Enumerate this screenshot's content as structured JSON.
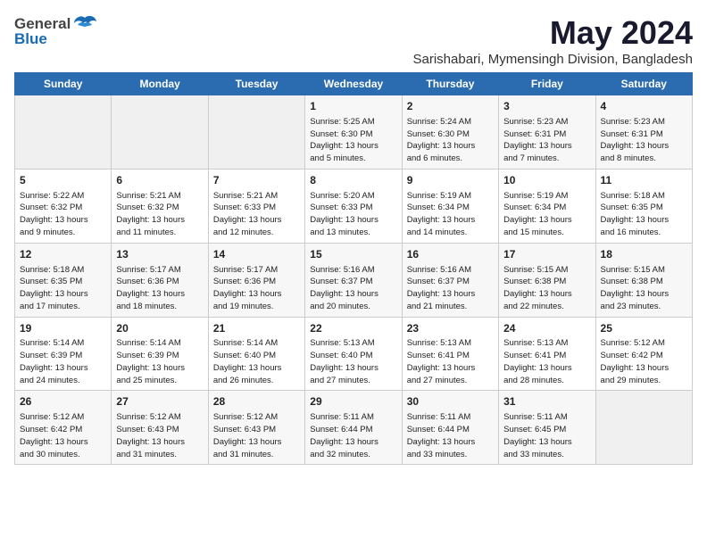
{
  "logo": {
    "general": "General",
    "blue": "Blue"
  },
  "title": "May 2024",
  "subtitle": "Sarishabari, Mymensingh Division, Bangladesh",
  "days_of_week": [
    "Sunday",
    "Monday",
    "Tuesday",
    "Wednesday",
    "Thursday",
    "Friday",
    "Saturday"
  ],
  "weeks": [
    [
      {
        "day": "",
        "info": ""
      },
      {
        "day": "",
        "info": ""
      },
      {
        "day": "",
        "info": ""
      },
      {
        "day": "1",
        "info": "Sunrise: 5:25 AM\nSunset: 6:30 PM\nDaylight: 13 hours\nand 5 minutes."
      },
      {
        "day": "2",
        "info": "Sunrise: 5:24 AM\nSunset: 6:30 PM\nDaylight: 13 hours\nand 6 minutes."
      },
      {
        "day": "3",
        "info": "Sunrise: 5:23 AM\nSunset: 6:31 PM\nDaylight: 13 hours\nand 7 minutes."
      },
      {
        "day": "4",
        "info": "Sunrise: 5:23 AM\nSunset: 6:31 PM\nDaylight: 13 hours\nand 8 minutes."
      }
    ],
    [
      {
        "day": "5",
        "info": "Sunrise: 5:22 AM\nSunset: 6:32 PM\nDaylight: 13 hours\nand 9 minutes."
      },
      {
        "day": "6",
        "info": "Sunrise: 5:21 AM\nSunset: 6:32 PM\nDaylight: 13 hours\nand 11 minutes."
      },
      {
        "day": "7",
        "info": "Sunrise: 5:21 AM\nSunset: 6:33 PM\nDaylight: 13 hours\nand 12 minutes."
      },
      {
        "day": "8",
        "info": "Sunrise: 5:20 AM\nSunset: 6:33 PM\nDaylight: 13 hours\nand 13 minutes."
      },
      {
        "day": "9",
        "info": "Sunrise: 5:19 AM\nSunset: 6:34 PM\nDaylight: 13 hours\nand 14 minutes."
      },
      {
        "day": "10",
        "info": "Sunrise: 5:19 AM\nSunset: 6:34 PM\nDaylight: 13 hours\nand 15 minutes."
      },
      {
        "day": "11",
        "info": "Sunrise: 5:18 AM\nSunset: 6:35 PM\nDaylight: 13 hours\nand 16 minutes."
      }
    ],
    [
      {
        "day": "12",
        "info": "Sunrise: 5:18 AM\nSunset: 6:35 PM\nDaylight: 13 hours\nand 17 minutes."
      },
      {
        "day": "13",
        "info": "Sunrise: 5:17 AM\nSunset: 6:36 PM\nDaylight: 13 hours\nand 18 minutes."
      },
      {
        "day": "14",
        "info": "Sunrise: 5:17 AM\nSunset: 6:36 PM\nDaylight: 13 hours\nand 19 minutes."
      },
      {
        "day": "15",
        "info": "Sunrise: 5:16 AM\nSunset: 6:37 PM\nDaylight: 13 hours\nand 20 minutes."
      },
      {
        "day": "16",
        "info": "Sunrise: 5:16 AM\nSunset: 6:37 PM\nDaylight: 13 hours\nand 21 minutes."
      },
      {
        "day": "17",
        "info": "Sunrise: 5:15 AM\nSunset: 6:38 PM\nDaylight: 13 hours\nand 22 minutes."
      },
      {
        "day": "18",
        "info": "Sunrise: 5:15 AM\nSunset: 6:38 PM\nDaylight: 13 hours\nand 23 minutes."
      }
    ],
    [
      {
        "day": "19",
        "info": "Sunrise: 5:14 AM\nSunset: 6:39 PM\nDaylight: 13 hours\nand 24 minutes."
      },
      {
        "day": "20",
        "info": "Sunrise: 5:14 AM\nSunset: 6:39 PM\nDaylight: 13 hours\nand 25 minutes."
      },
      {
        "day": "21",
        "info": "Sunrise: 5:14 AM\nSunset: 6:40 PM\nDaylight: 13 hours\nand 26 minutes."
      },
      {
        "day": "22",
        "info": "Sunrise: 5:13 AM\nSunset: 6:40 PM\nDaylight: 13 hours\nand 27 minutes."
      },
      {
        "day": "23",
        "info": "Sunrise: 5:13 AM\nSunset: 6:41 PM\nDaylight: 13 hours\nand 27 minutes."
      },
      {
        "day": "24",
        "info": "Sunrise: 5:13 AM\nSunset: 6:41 PM\nDaylight: 13 hours\nand 28 minutes."
      },
      {
        "day": "25",
        "info": "Sunrise: 5:12 AM\nSunset: 6:42 PM\nDaylight: 13 hours\nand 29 minutes."
      }
    ],
    [
      {
        "day": "26",
        "info": "Sunrise: 5:12 AM\nSunset: 6:42 PM\nDaylight: 13 hours\nand 30 minutes."
      },
      {
        "day": "27",
        "info": "Sunrise: 5:12 AM\nSunset: 6:43 PM\nDaylight: 13 hours\nand 31 minutes."
      },
      {
        "day": "28",
        "info": "Sunrise: 5:12 AM\nSunset: 6:43 PM\nDaylight: 13 hours\nand 31 minutes."
      },
      {
        "day": "29",
        "info": "Sunrise: 5:11 AM\nSunset: 6:44 PM\nDaylight: 13 hours\nand 32 minutes."
      },
      {
        "day": "30",
        "info": "Sunrise: 5:11 AM\nSunset: 6:44 PM\nDaylight: 13 hours\nand 33 minutes."
      },
      {
        "day": "31",
        "info": "Sunrise: 5:11 AM\nSunset: 6:45 PM\nDaylight: 13 hours\nand 33 minutes."
      },
      {
        "day": "",
        "info": ""
      }
    ]
  ]
}
